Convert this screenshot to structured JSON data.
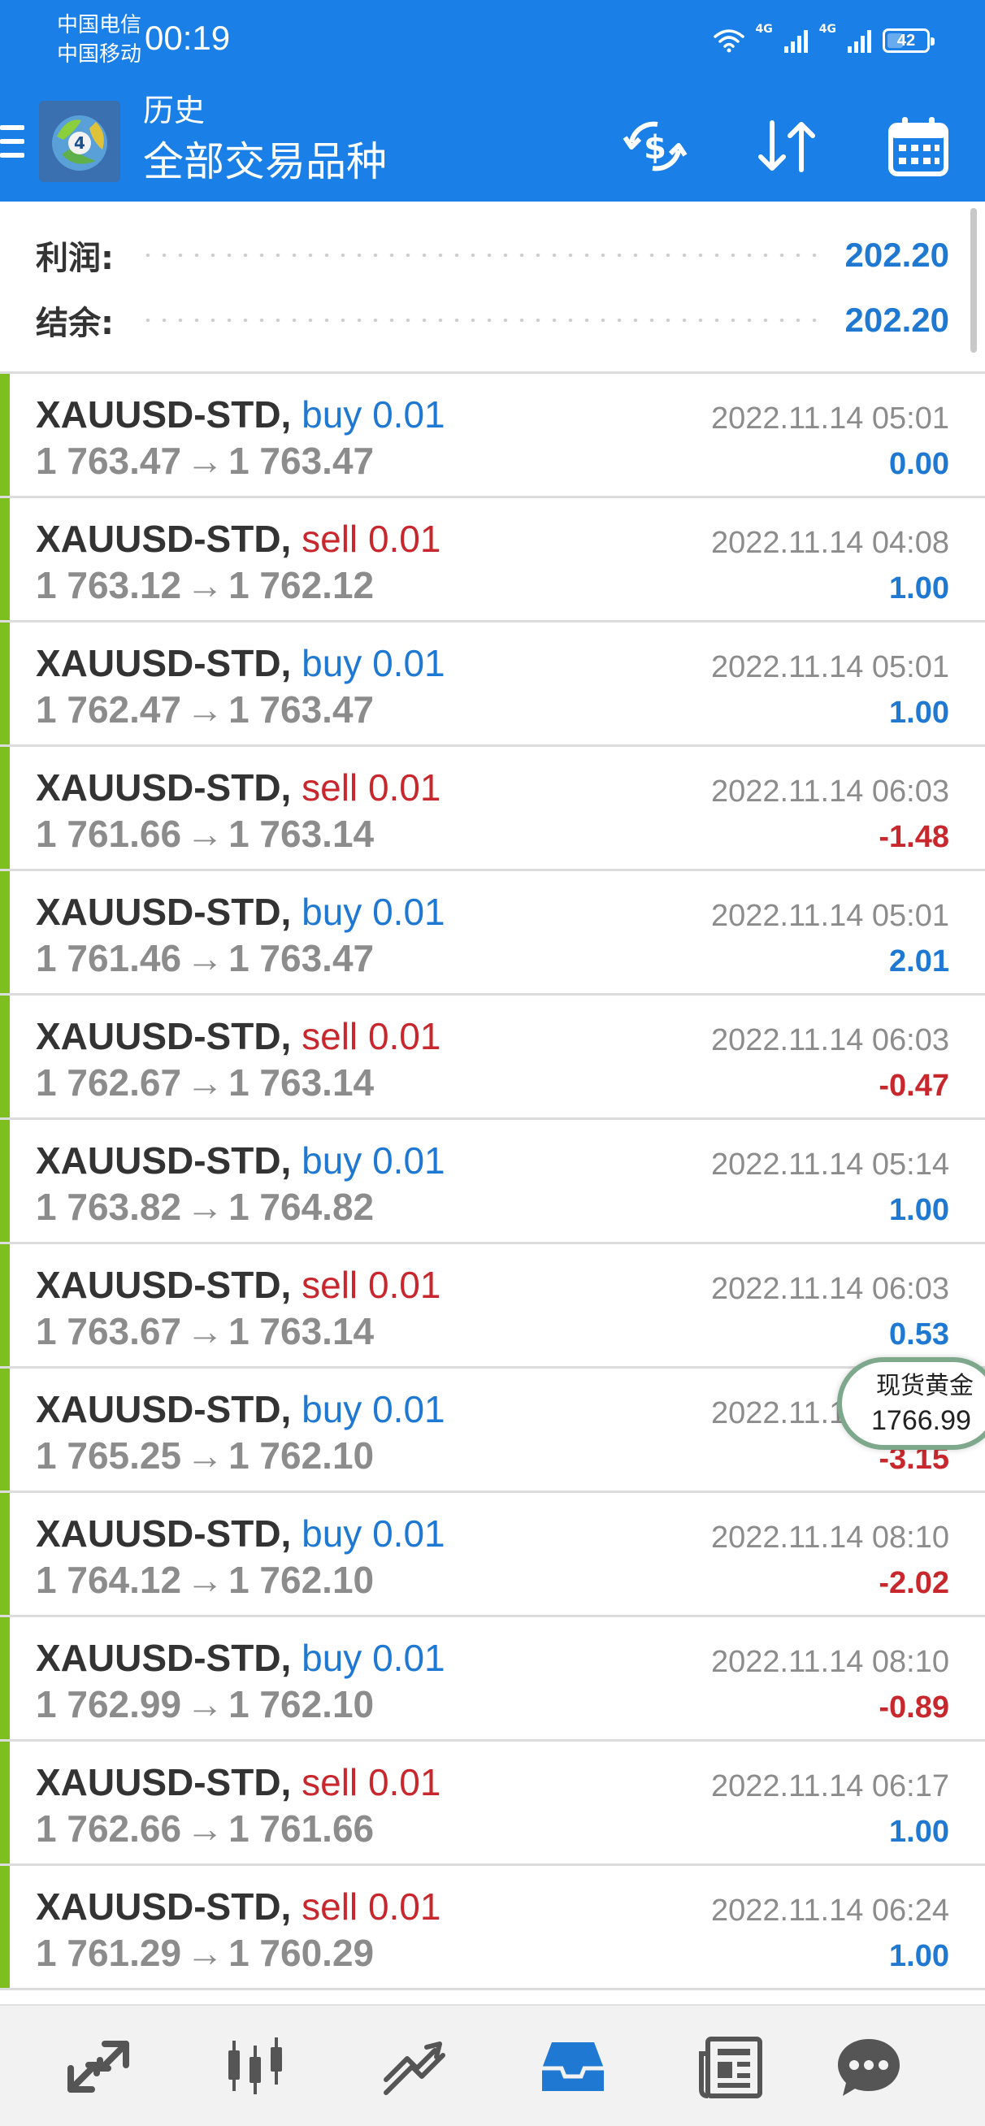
{
  "status_bar": {
    "carrier1": "中国电信",
    "carrier2": "中国移动",
    "time": "00:19",
    "network1": "4G",
    "network2": "4G",
    "battery": "42"
  },
  "header": {
    "subtitle": "历史",
    "title": "全部交易品种",
    "menu_icon": "hamburger-icon",
    "logo_icon": "metatrader-logo",
    "actions": [
      "currency-swap-icon",
      "sort-icon",
      "calendar-icon"
    ]
  },
  "summary": {
    "profit_label": "利润:",
    "profit_value": "202.20",
    "balance_label": "结余:",
    "balance_value": "202.20"
  },
  "deals": [
    {
      "symbol": "XAUUSD-STD,",
      "direction": "buy",
      "volume": "0.01",
      "open": "1 763.47",
      "close": "1 763.47",
      "time": "2022.11.14 05:01",
      "profit": "0.00"
    },
    {
      "symbol": "XAUUSD-STD,",
      "direction": "sell",
      "volume": "0.01",
      "open": "1 763.12",
      "close": "1 762.12",
      "time": "2022.11.14 04:08",
      "profit": "1.00"
    },
    {
      "symbol": "XAUUSD-STD,",
      "direction": "buy",
      "volume": "0.01",
      "open": "1 762.47",
      "close": "1 763.47",
      "time": "2022.11.14 05:01",
      "profit": "1.00"
    },
    {
      "symbol": "XAUUSD-STD,",
      "direction": "sell",
      "volume": "0.01",
      "open": "1 761.66",
      "close": "1 763.14",
      "time": "2022.11.14 06:03",
      "profit": "-1.48"
    },
    {
      "symbol": "XAUUSD-STD,",
      "direction": "buy",
      "volume": "0.01",
      "open": "1 761.46",
      "close": "1 763.47",
      "time": "2022.11.14 05:01",
      "profit": "2.01"
    },
    {
      "symbol": "XAUUSD-STD,",
      "direction": "sell",
      "volume": "0.01",
      "open": "1 762.67",
      "close": "1 763.14",
      "time": "2022.11.14 06:03",
      "profit": "-0.47"
    },
    {
      "symbol": "XAUUSD-STD,",
      "direction": "buy",
      "volume": "0.01",
      "open": "1 763.82",
      "close": "1 764.82",
      "time": "2022.11.14 05:14",
      "profit": "1.00"
    },
    {
      "symbol": "XAUUSD-STD,",
      "direction": "sell",
      "volume": "0.01",
      "open": "1 763.67",
      "close": "1 763.14",
      "time": "2022.11.14 06:03",
      "profit": "0.53"
    },
    {
      "symbol": "XAUUSD-STD,",
      "direction": "buy",
      "volume": "0.01",
      "open": "1 765.25",
      "close": "1 762.10",
      "time": "2022.11.14 08:10",
      "profit": "-3.15"
    },
    {
      "symbol": "XAUUSD-STD,",
      "direction": "buy",
      "volume": "0.01",
      "open": "1 764.12",
      "close": "1 762.10",
      "time": "2022.11.14 08:10",
      "profit": "-2.02"
    },
    {
      "symbol": "XAUUSD-STD,",
      "direction": "buy",
      "volume": "0.01",
      "open": "1 762.99",
      "close": "1 762.10",
      "time": "2022.11.14 08:10",
      "profit": "-0.89"
    },
    {
      "symbol": "XAUUSD-STD,",
      "direction": "sell",
      "volume": "0.01",
      "open": "1 762.66",
      "close": "1 761.66",
      "time": "2022.11.14 06:17",
      "profit": "1.00"
    },
    {
      "symbol": "XAUUSD-STD,",
      "direction": "sell",
      "volume": "0.01",
      "open": "1 761.29",
      "close": "1 760.29",
      "time": "2022.11.14 06:24",
      "profit": "1.00"
    }
  ],
  "price_widget": {
    "name": "现货黄金",
    "price": "1766.99"
  },
  "bottom_nav": {
    "items": [
      "quotes-icon",
      "chart-icon",
      "trade-icon",
      "history-icon",
      "news-icon",
      "chat-icon"
    ],
    "active": "history-icon"
  },
  "colors": {
    "header_blue": "#1a7fe6",
    "buy_blue": "#1f78d1",
    "sell_red": "#c8282d",
    "accent_green": "#7cbf1e",
    "muted_gray": "#8c8c8c"
  }
}
